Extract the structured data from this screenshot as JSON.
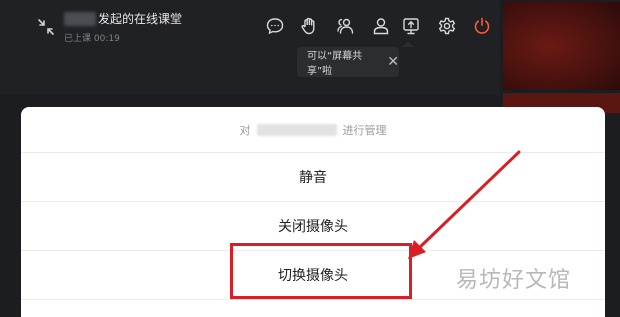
{
  "header": {
    "title_suffix": "发起的在线课堂",
    "status": "已上课 00:19",
    "toolbar": [
      {
        "icon": "chat-bubble-icon"
      },
      {
        "icon": "raise-hand-icon"
      },
      {
        "icon": "members-icon"
      },
      {
        "icon": "user-icon"
      },
      {
        "icon": "screen-share-icon"
      },
      {
        "icon": "gear-icon"
      },
      {
        "icon": "power-icon",
        "color": "#ff5a3c"
      }
    ]
  },
  "tooltip": {
    "text": "可以“屏幕共享”啦",
    "close": "✕"
  },
  "sheet": {
    "header_prefix": "对",
    "header_suffix": "进行管理",
    "items": [
      {
        "label": "静音"
      },
      {
        "label": "关闭摄像头"
      },
      {
        "label": "切换摄像头"
      }
    ]
  },
  "colors": {
    "highlight": "#d91f26",
    "accent": "#ff5a3c"
  },
  "watermark": "易坊好文馆"
}
